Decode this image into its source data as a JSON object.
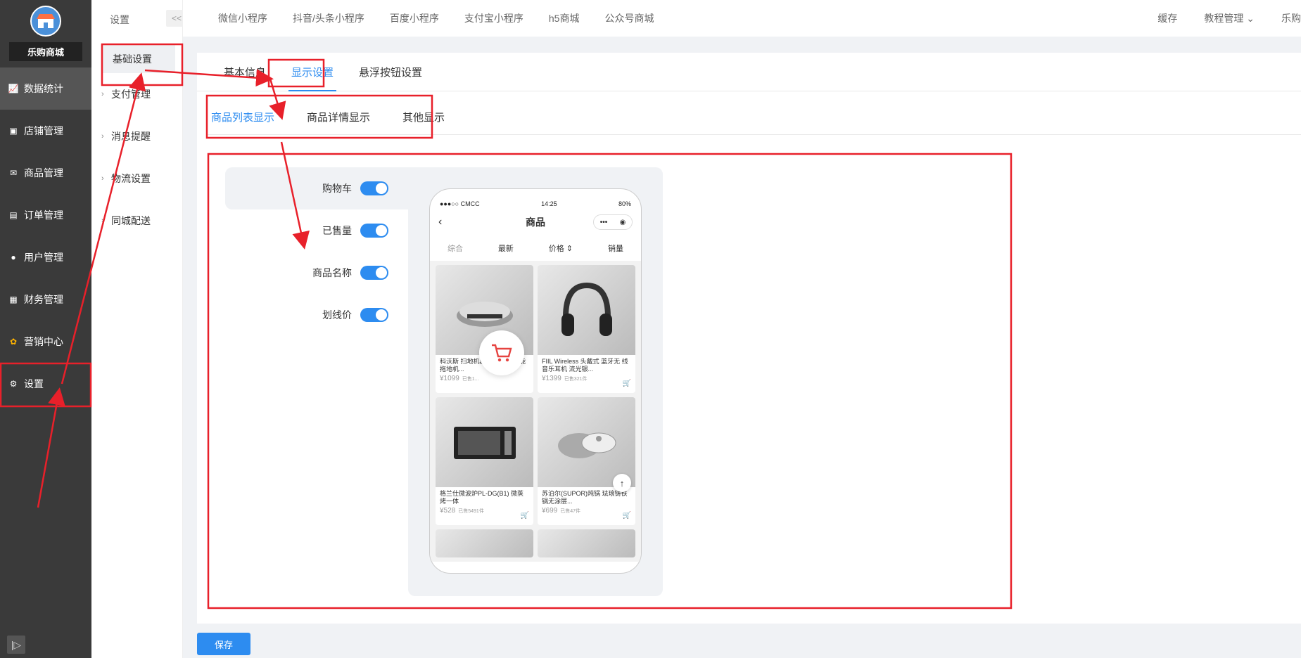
{
  "sidebar": {
    "shop_name": "乐购商城",
    "items": [
      {
        "label": "数据统计",
        "icon": "chart-icon"
      },
      {
        "label": "店铺管理",
        "icon": "store-icon"
      },
      {
        "label": "商品管理",
        "icon": "goods-icon"
      },
      {
        "label": "订单管理",
        "icon": "order-icon"
      },
      {
        "label": "用户管理",
        "icon": "user-icon"
      },
      {
        "label": "财务管理",
        "icon": "finance-icon"
      },
      {
        "label": "营销中心",
        "icon": "marketing-icon"
      },
      {
        "label": "设置",
        "icon": "gear-icon"
      }
    ],
    "collapse_label": "|▷"
  },
  "sub_sidebar": {
    "header": "设置",
    "toggle": "<<",
    "items": [
      {
        "label": "基础设置"
      },
      {
        "label": "支付管理"
      },
      {
        "label": "消息提醒"
      },
      {
        "label": "物流设置"
      },
      {
        "label": "同城配送"
      }
    ]
  },
  "topnav": {
    "links": [
      "微信小程序",
      "抖音/头条小程序",
      "百度小程序",
      "支付宝小程序",
      "h5商城",
      "公众号商城"
    ],
    "right": {
      "cache": "缓存",
      "tutorial": "教程管理",
      "user": "乐购"
    }
  },
  "main": {
    "tabs": [
      "基本信息",
      "显示设置",
      "悬浮按钮设置"
    ],
    "sub_tabs": [
      "商品列表显示",
      "商品详情显示",
      "其他显示"
    ],
    "toggles": [
      {
        "label": "购物车",
        "on": true
      },
      {
        "label": "已售量",
        "on": true
      },
      {
        "label": "商品名称",
        "on": true
      },
      {
        "label": "划线价",
        "on": true
      }
    ]
  },
  "phone": {
    "carrier": "●●●○○ CMCC",
    "time": "14:25",
    "battery": "80%",
    "title": "商品",
    "sort": [
      "综合",
      "最新",
      "价格 ⇕",
      "销量"
    ],
    "products": [
      {
        "name": "科沃斯 扫地机器人 全自动智能拖地机...",
        "price": "¥1099",
        "sold": "已售1..."
      },
      {
        "name": "FIIL Wireless 头戴式 蓝牙无 线音乐耳机 流光银...",
        "price": "¥1399",
        "sold": "已售321件"
      },
      {
        "name": "格兰仕微波炉PL-DG(B1) 微蒸烤一体",
        "price": "¥528",
        "sold": "已售5491件"
      },
      {
        "name": "苏泊尔(SUPOR)炖锅 珐琅铸铁锅无涂层...",
        "price": "¥699",
        "sold": "已售47件"
      }
    ]
  },
  "save_label": "保存",
  "colors": {
    "primary": "#2d8cf0",
    "sidebar": "#3a3a3a",
    "annotation": "#e8202a"
  }
}
